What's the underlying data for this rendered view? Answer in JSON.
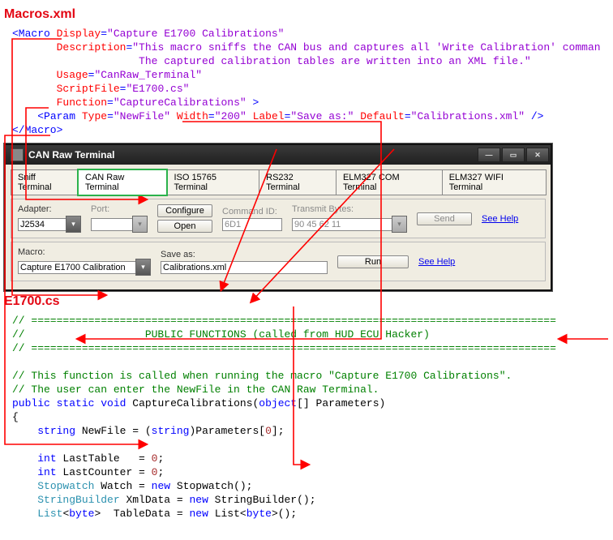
{
  "headings": {
    "xml": "Macros.xml",
    "cs": "E1700.cs"
  },
  "xml": {
    "open": "<Macro",
    "attrs": {
      "display_k": "Display",
      "display_v": "\"Capture E1700 Calibrations\"",
      "desc_k": "Description",
      "desc_v1": "\"This macro sniffs the CAN bus and captures all 'Write Calibration' comman",
      "desc_v2": "The captured calibration tables are written into an XML file.\"",
      "usage_k": "Usage",
      "usage_v": "\"CanRaw_Terminal\"",
      "script_k": "ScriptFile",
      "script_v": "\"E1700.cs\"",
      "func_k": "Function",
      "func_v": "\"CaptureCalibrations\"",
      "close_angle": " >"
    },
    "param": {
      "open": "<Param",
      "type_k": "Type",
      "type_v": "\"NewFile\"",
      "width_k": "Width",
      "width_v": "\"200\"",
      "label_k": "Label",
      "label_v": "\"Save as:\"",
      "default_k": "Default",
      "default_v": "\"Calibrations.xml\"",
      "close": " />"
    },
    "end": "</Macro>"
  },
  "win": {
    "title": "CAN Raw Terminal",
    "tabs": [
      "Sniff Terminal",
      "CAN Raw Terminal",
      "ISO 15765 Terminal",
      "RS232 Terminal",
      "ELM327 COM Terminal",
      "ELM327 WIFI Terminal"
    ],
    "row1": {
      "adapter_lbl": "Adapter:",
      "adapter_val": "J2534",
      "port_lbl": "Port:",
      "configure": "Configure",
      "open": "Open",
      "cmd_lbl": "Command ID:",
      "cmd_val": "6D1",
      "tx_lbl": "Transmit Bytes:",
      "tx_val": "90 45 62 11",
      "send": "Send",
      "help": "See Help"
    },
    "row2": {
      "macro_lbl": "Macro:",
      "macro_val": "Capture E1700 Calibration",
      "save_lbl": "Save as:",
      "save_val": "Calibrations.xml",
      "run": "Run",
      "help": "See Help"
    }
  },
  "cs": {
    "bar1": "// ===================================================================================",
    "bar2": "//                   PUBLIC FUNCTIONS (called from HUD ECU Hacker)",
    "bar3": "// ===================================================================================",
    "c1": "// This function is called when running the macro \"Capture E1700 Calibrations\".",
    "c2": "// The user can enter the NewFile in the CAN Raw Terminal.",
    "sig": {
      "pub": "public",
      "stat": "static",
      "void": "void",
      "name": " CaptureCalibrations(",
      "obj": "object",
      "tail": "[] Parameters)"
    },
    "brace_o": "{",
    "nf": {
      "str": "string",
      "txt1": " NewFile = (",
      "str2": "string",
      "txt2": ")Parameters[",
      "zero": "0",
      "txt3": "];"
    },
    "lt": {
      "int": "int",
      "txt": " LastTable   = ",
      "zero": "0",
      "semi": ";"
    },
    "lc": {
      "int": "int",
      "txt": " LastCounter = ",
      "zero": "0",
      "semi": ";"
    },
    "sw": {
      "t": "Stopwatch",
      "mid": " Watch = ",
      "new": "new",
      "tail": " Stopwatch();"
    },
    "sb": {
      "t": "StringBuilder",
      "mid": " XmlData = ",
      "new": "new",
      "tail": " StringBuilder();"
    },
    "ls": {
      "t1": "List",
      "lt": "<",
      "t2": "byte",
      "gt1": ">  TableData = ",
      "new": "new",
      "t3": " List",
      "lt2": "<",
      "t4": "byte",
      "gt2": ">();"
    }
  }
}
